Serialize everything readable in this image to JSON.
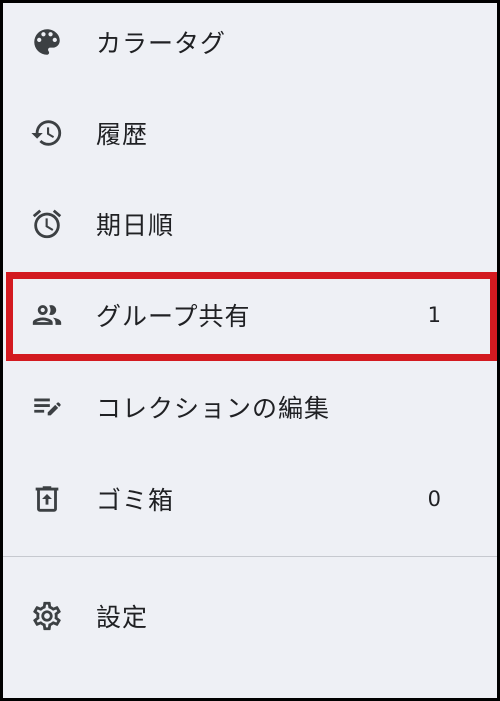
{
  "menu": {
    "items": [
      {
        "label": "カラータグ",
        "icon": "palette-icon"
      },
      {
        "label": "履歴",
        "icon": "history-icon"
      },
      {
        "label": "期日順",
        "icon": "alarm-icon"
      },
      {
        "label": "グループ共有",
        "icon": "group-icon",
        "count": "1",
        "highlighted": true
      },
      {
        "label": "コレクションの編集",
        "icon": "edit-list-icon"
      },
      {
        "label": "ゴミ箱",
        "icon": "trash-icon",
        "count": "0"
      },
      {
        "label": "設定",
        "icon": "gear-icon"
      }
    ]
  },
  "colors": {
    "background": "#eef0f5",
    "text": "#202124",
    "highlight_border": "#d31a20",
    "divider": "#c6c9cf",
    "icon": "#3c4043"
  }
}
